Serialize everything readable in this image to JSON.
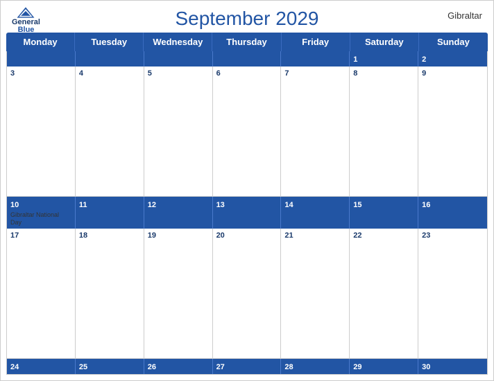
{
  "header": {
    "title": "September 2029",
    "region": "Gibraltar",
    "logo": {
      "general": "General",
      "blue": "Blue"
    }
  },
  "dayHeaders": [
    "Monday",
    "Tuesday",
    "Wednesday",
    "Thursday",
    "Friday",
    "Saturday",
    "Sunday"
  ],
  "weeks": [
    {
      "isHeaderRow": true,
      "days": [
        {
          "number": "",
          "empty": true
        },
        {
          "number": "",
          "empty": true
        },
        {
          "number": "",
          "empty": true
        },
        {
          "number": "",
          "empty": true
        },
        {
          "number": "",
          "empty": true
        },
        {
          "number": "1",
          "empty": false
        },
        {
          "number": "2",
          "empty": false
        }
      ]
    },
    {
      "isHeaderRow": false,
      "days": [
        {
          "number": "3",
          "empty": false
        },
        {
          "number": "4",
          "empty": false
        },
        {
          "number": "5",
          "empty": false
        },
        {
          "number": "6",
          "empty": false
        },
        {
          "number": "7",
          "empty": false
        },
        {
          "number": "8",
          "empty": false
        },
        {
          "number": "9",
          "empty": false
        }
      ]
    },
    {
      "isHeaderRow": true,
      "days": [
        {
          "number": "10",
          "empty": false,
          "event": "Gibraltar National Day"
        },
        {
          "number": "11",
          "empty": false
        },
        {
          "number": "12",
          "empty": false
        },
        {
          "number": "13",
          "empty": false
        },
        {
          "number": "14",
          "empty": false
        },
        {
          "number": "15",
          "empty": false
        },
        {
          "number": "16",
          "empty": false
        }
      ]
    },
    {
      "isHeaderRow": false,
      "days": [
        {
          "number": "17",
          "empty": false
        },
        {
          "number": "18",
          "empty": false
        },
        {
          "number": "19",
          "empty": false
        },
        {
          "number": "20",
          "empty": false
        },
        {
          "number": "21",
          "empty": false
        },
        {
          "number": "22",
          "empty": false
        },
        {
          "number": "23",
          "empty": false
        }
      ]
    },
    {
      "isHeaderRow": true,
      "days": [
        {
          "number": "24",
          "empty": false
        },
        {
          "number": "25",
          "empty": false
        },
        {
          "number": "26",
          "empty": false
        },
        {
          "number": "27",
          "empty": false
        },
        {
          "number": "28",
          "empty": false
        },
        {
          "number": "29",
          "empty": false
        },
        {
          "number": "30",
          "empty": false
        }
      ]
    }
  ],
  "colors": {
    "headerBg": "#2255a4",
    "headerText": "#ffffff",
    "dayNumberColor": "#1a3a6b",
    "borderColor": "#cccccc"
  }
}
